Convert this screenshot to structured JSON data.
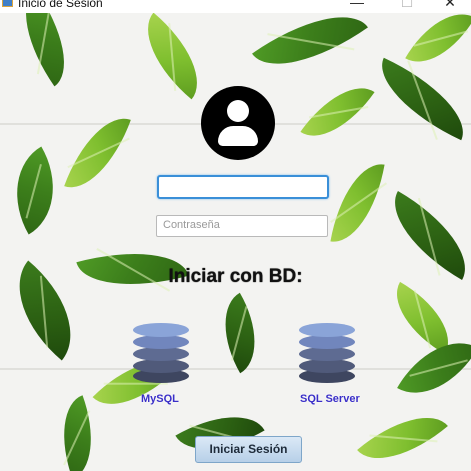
{
  "window": {
    "title": "Inicio de Sesión",
    "controls": {
      "minimize": "—",
      "maximize": "☐",
      "close": "✕"
    }
  },
  "login": {
    "username_value": "",
    "password_placeholder": "Contraseña",
    "heading": "Iniciar con BD:",
    "databases": [
      {
        "label": "MySQL",
        "icon": "database-icon"
      },
      {
        "label": "SQL Server",
        "icon": "database-icon"
      }
    ],
    "submit_label": "Iniciar Sesión"
  },
  "colors": {
    "field_focus": "#3a8fd8",
    "db_label": "#3a2fc8",
    "db_top": "#8aa4d8",
    "db_bottom": "#3e4660"
  }
}
